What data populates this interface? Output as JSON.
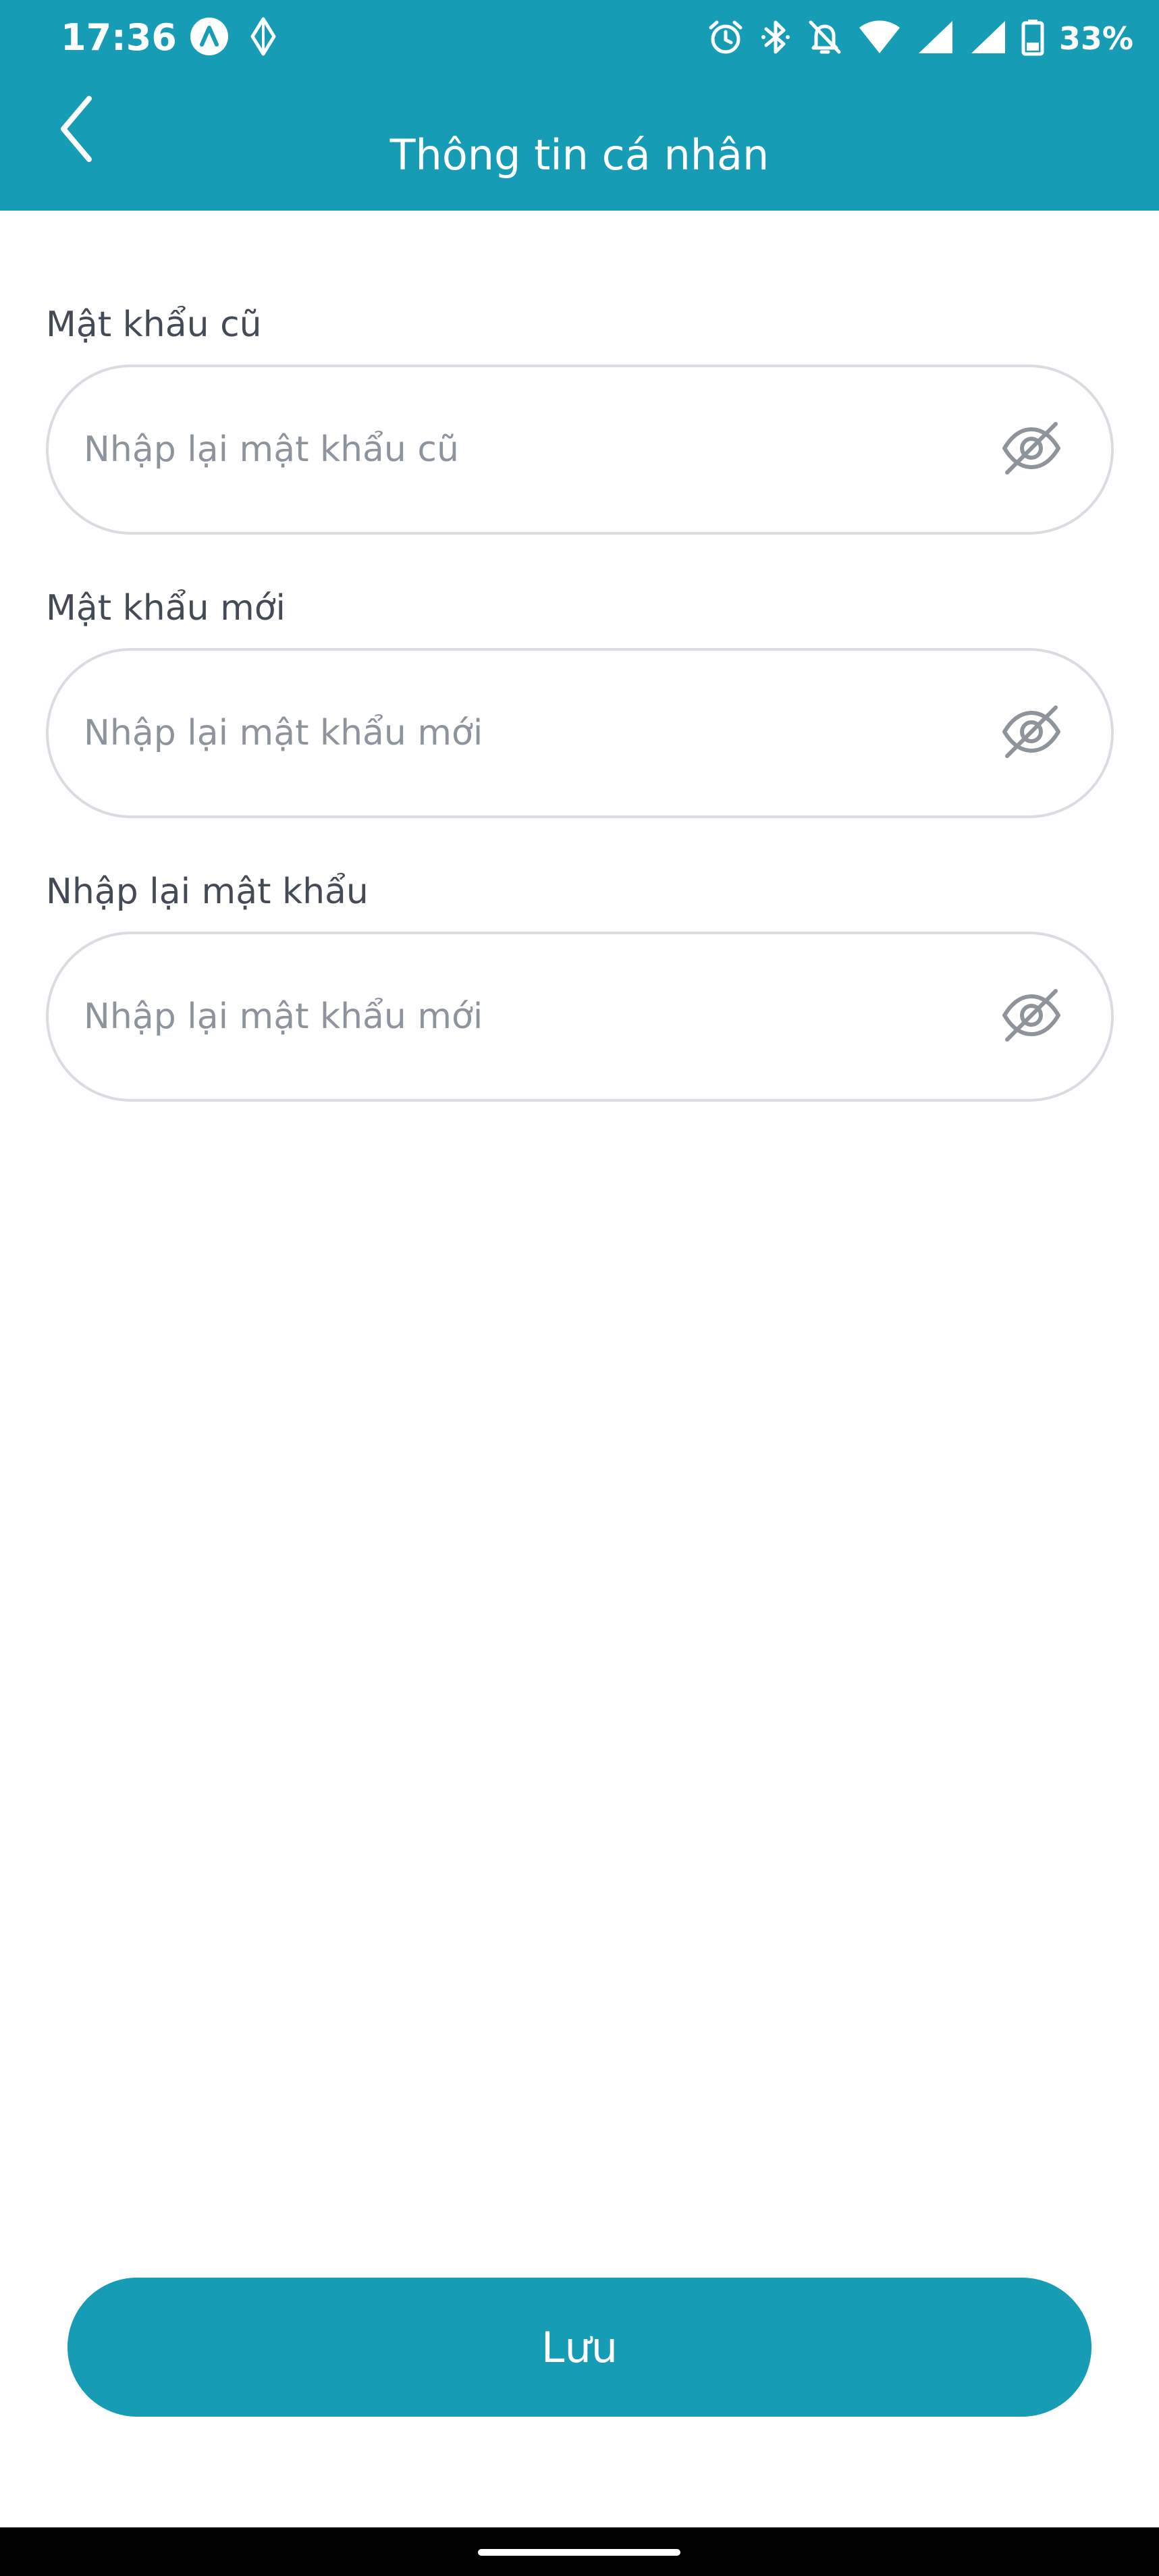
{
  "status_bar": {
    "time": "17:36",
    "battery": "33%",
    "left_icons": [
      "app-notification-icon",
      "location-diamond-icon"
    ],
    "right_icons": [
      "alarm-icon",
      "bluetooth-icon",
      "notifications-off-icon",
      "wifi-icon",
      "cell-signal-icon",
      "cell-signal-icon",
      "battery-icon"
    ]
  },
  "header": {
    "title": "Thông tin cá nhân",
    "back_icon": "chevron-left-icon"
  },
  "form": {
    "old_password": {
      "label": "Mật khẩu cũ",
      "placeholder": "Nhập lại mật khẩu cũ",
      "value": "",
      "toggle_icon": "eye-off-icon"
    },
    "new_password": {
      "label": "Mật khẩu mới",
      "placeholder": "Nhập lại mật khẩu mới",
      "value": "",
      "toggle_icon": "eye-off-icon"
    },
    "confirm_password": {
      "label": "Nhập lại mật khẩu",
      "placeholder": "Nhập lại mật khẩu mới",
      "value": "",
      "toggle_icon": "eye-off-icon"
    }
  },
  "actions": {
    "save_label": "Lưu"
  },
  "colors": {
    "primary": "#169cb5",
    "label_text": "#454b56",
    "placeholder_text": "#8e949d",
    "field_border": "#d9dce1",
    "icon_gray": "#8f949b"
  }
}
